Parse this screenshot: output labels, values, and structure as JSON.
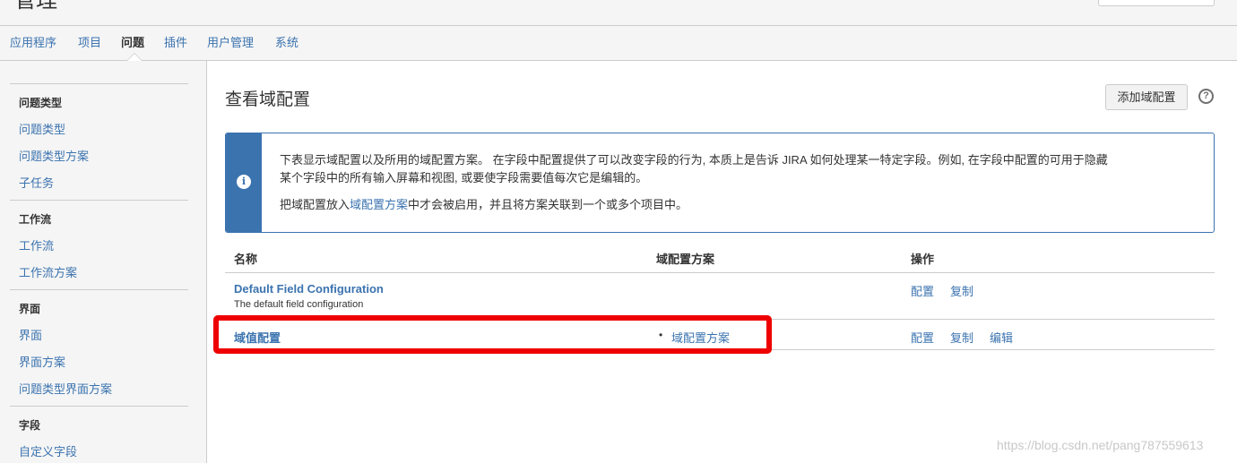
{
  "header": {
    "title": "管理"
  },
  "nav": {
    "tabs": [
      {
        "label": "应用程序"
      },
      {
        "label": "项目"
      },
      {
        "label": "问题"
      },
      {
        "label": "插件"
      },
      {
        "label": "用户管理"
      },
      {
        "label": "系统"
      }
    ],
    "active_tab": "问题"
  },
  "sidebar": {
    "sections": [
      {
        "heading": "问题类型",
        "items": [
          "问题类型",
          "问题类型方案",
          "子任务"
        ]
      },
      {
        "heading": "工作流",
        "items": [
          "工作流",
          "工作流方案"
        ]
      },
      {
        "heading": "界面",
        "items": [
          "界面",
          "界面方案",
          "问题类型界面方案"
        ]
      },
      {
        "heading": "字段",
        "items": [
          "自定义字段"
        ]
      }
    ]
  },
  "main": {
    "title": "查看域配置",
    "add_button": "添加域配置",
    "help_icon": "?",
    "info": {
      "line1": "下表显示域配置以及所用的域配置方案。 在字段中配置提供了可以改变字段的行为, 本质上是告诉 JIRA 如何处理某一特定字段。例如, 在字段中配置的可用于隐藏",
      "line2": "某个字段中的所有输入屏幕和视图, 或要使字段需要值每次它是编辑的。",
      "line3_before": "把域配置放入",
      "line3_link": "域配置方案",
      "line3_after": "中才会被启用，并且将方案关联到一个或多个项目中。"
    },
    "table": {
      "headers": {
        "name": "名称",
        "scheme": "域配置方案",
        "ops": "操作"
      },
      "rows": [
        {
          "name": "Default Field Configuration",
          "description": "The default field configuration",
          "scheme": "",
          "ops": [
            "配置",
            "复制"
          ]
        },
        {
          "name": "域值配置",
          "description": "",
          "scheme": "域配置方案",
          "ops": [
            "配置",
            "复制",
            "编辑"
          ]
        }
      ]
    }
  },
  "annotation": {
    "color": "#ee0000"
  },
  "watermark": "https://blog.csdn.net/pang787559613",
  "colors": {
    "link": "#3b73af",
    "border": "#cccccc",
    "panel_bg": "#f5f5f5"
  }
}
